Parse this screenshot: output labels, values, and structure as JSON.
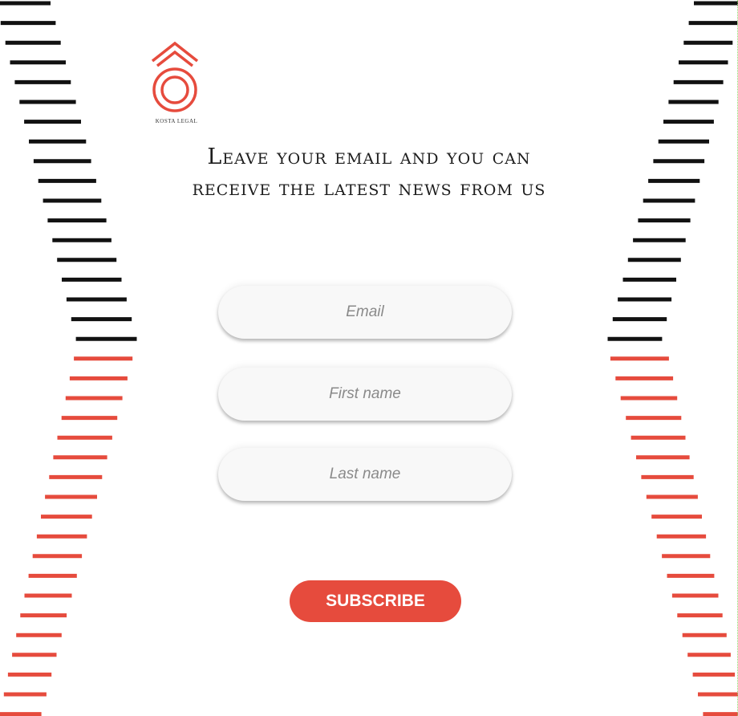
{
  "brand": {
    "logo_icon": "kosta-legal-logo-icon",
    "name": "KOSTA LEGAL",
    "accent_color": "#e64b3d"
  },
  "headline": {
    "line1": "Leave your email and you can",
    "line2": "receive the latest news from us"
  },
  "form": {
    "email_placeholder": "Email",
    "first_name_placeholder": "First name",
    "last_name_placeholder": "Last name",
    "subscribe_label": "SUBSCRIBE"
  },
  "decor": {
    "stripe_colors": [
      "#111111",
      "#e64b3d"
    ]
  }
}
